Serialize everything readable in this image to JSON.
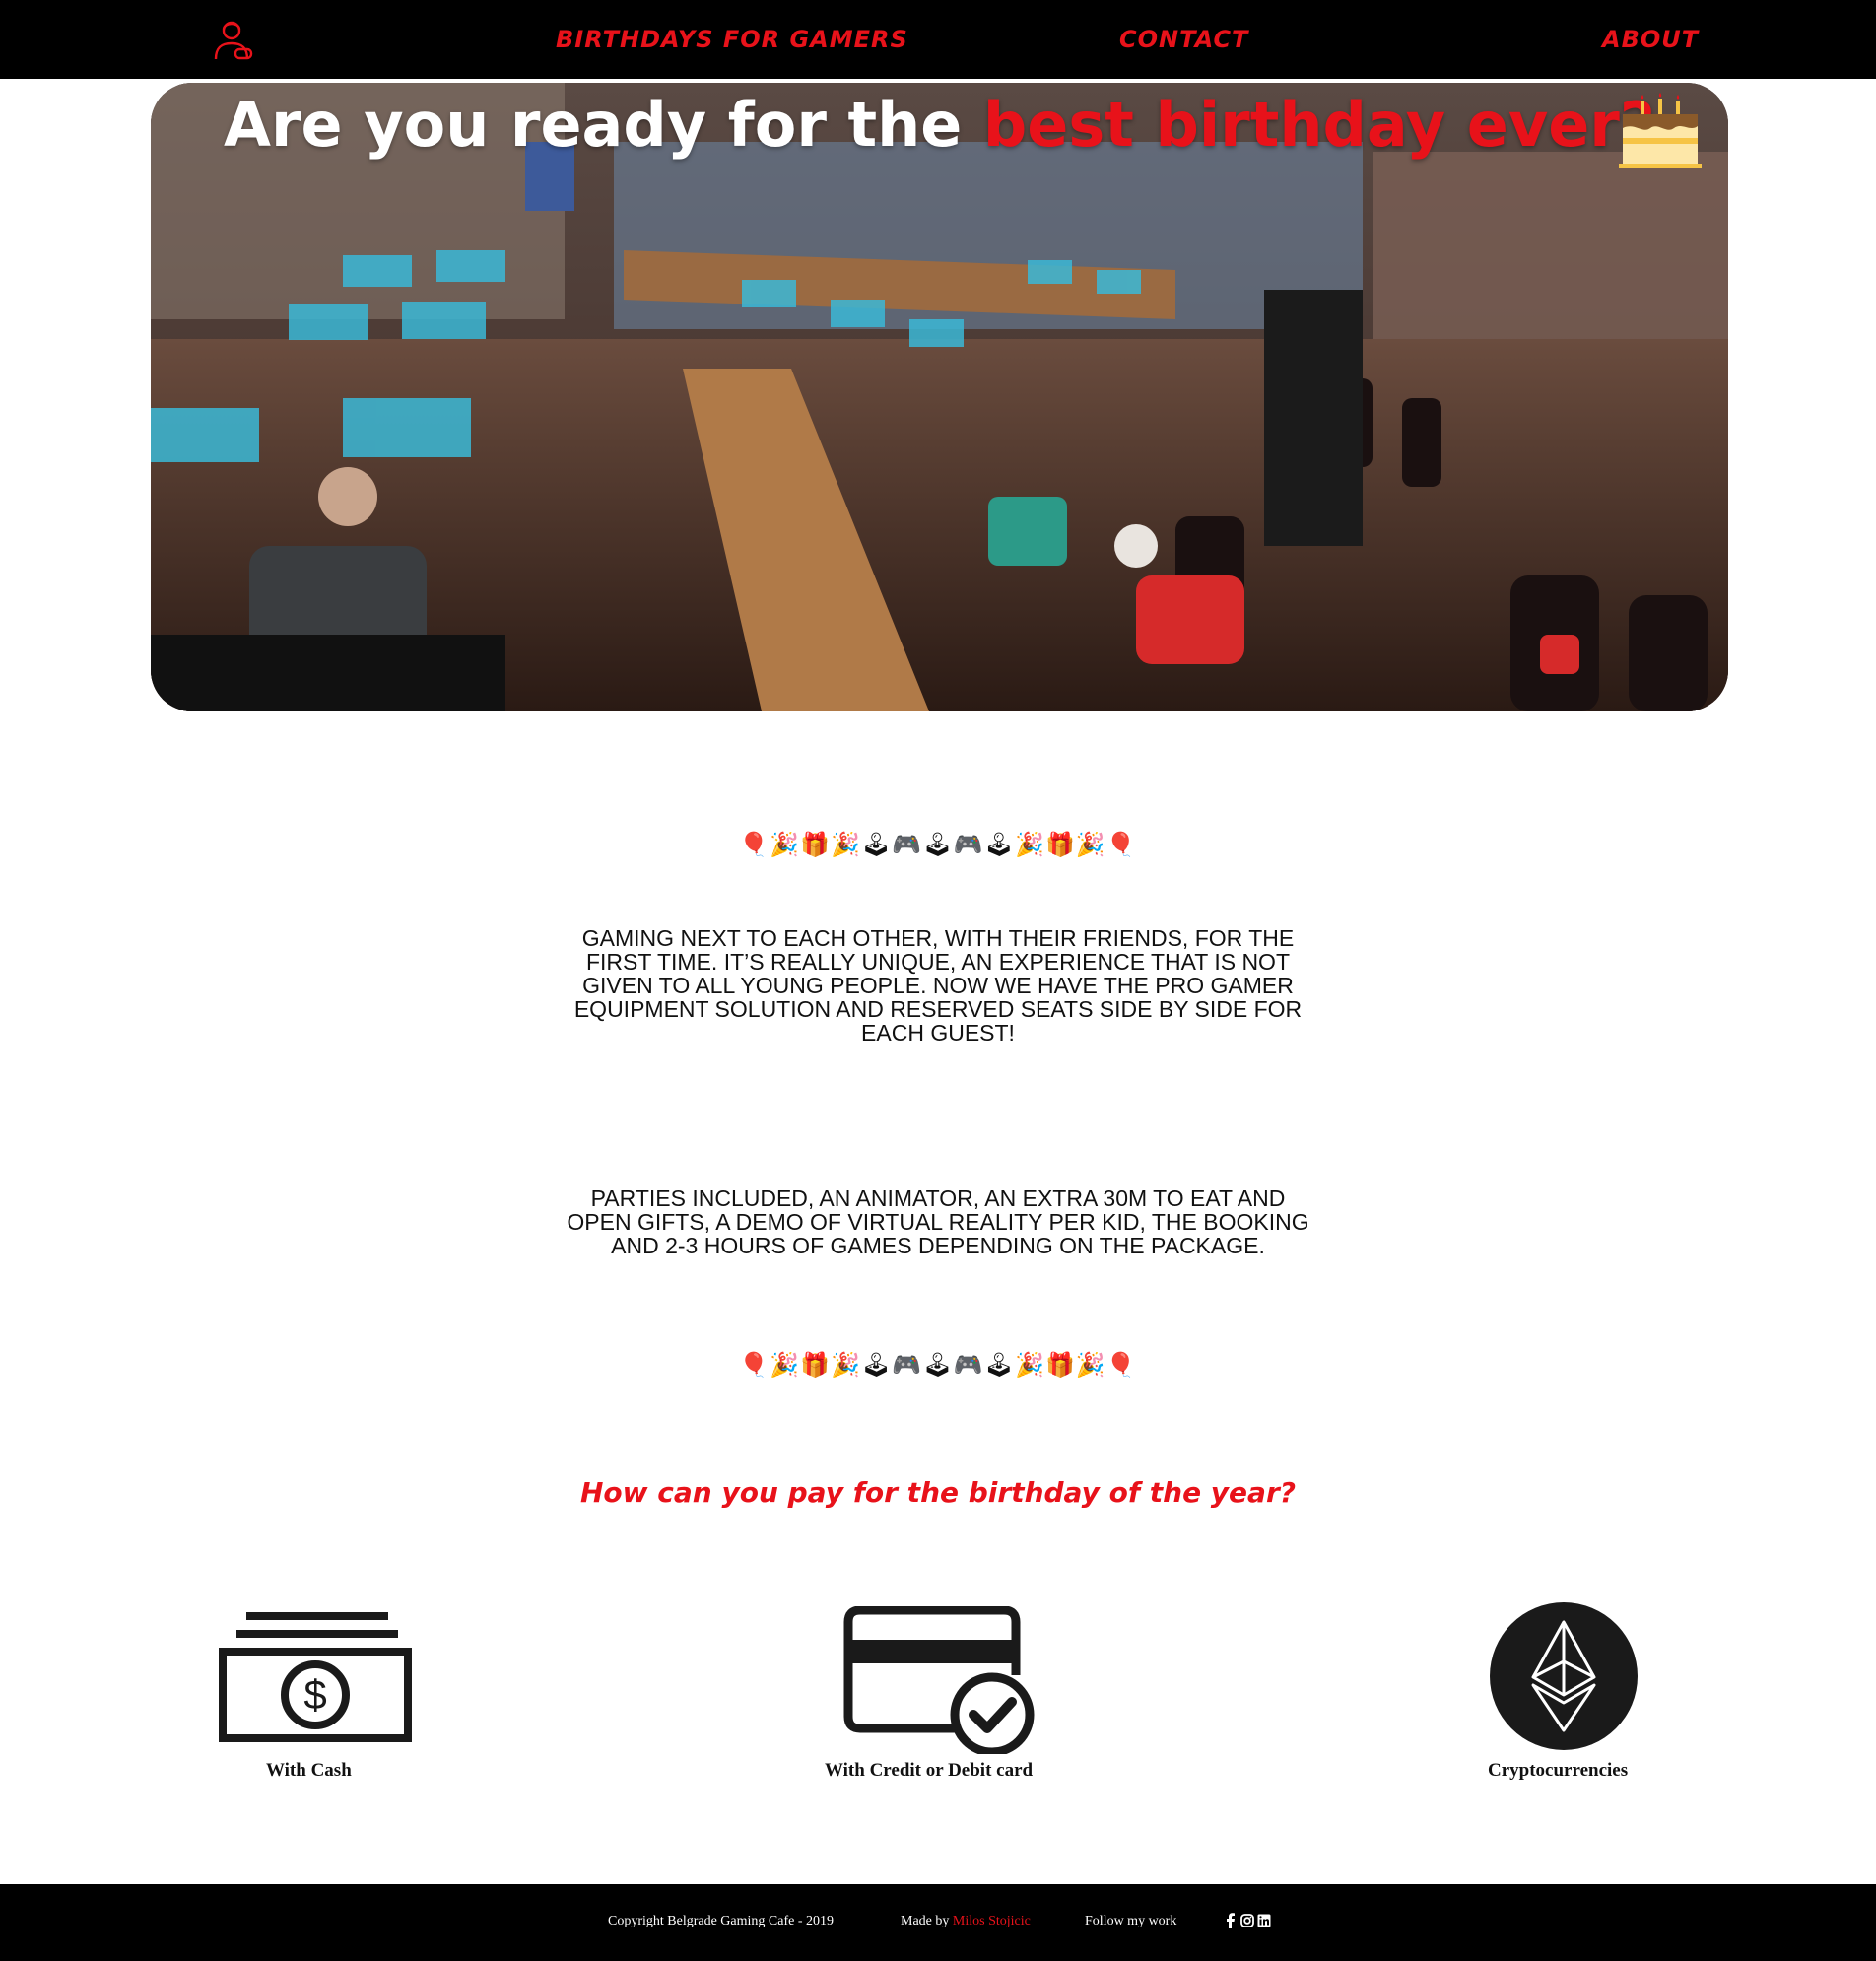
{
  "nav": {
    "logo_icon": "gamer-headset-icon",
    "links": [
      "BIRTHDAYS FOR GAMERS",
      "CONTACT",
      "ABOUT"
    ]
  },
  "hero": {
    "title_part1": "Are you ready for the ",
    "title_highlight": "best birthday ever?",
    "cake_icon": "birthday-cake-icon"
  },
  "emoji_strip": "🎈🎉🎁🎉🕹🎮🕹🎮🕹🎉🎁🎉🎈",
  "paragraphs": [
    "Gaming next to each other, with their friends, for the first time. It’s really unique, an experience that is not given to all young people. Now we have the pro gamer equipment solution and reserved seats side by side for each guest!",
    "Parties included, an animator, an extra 30m to eat and open gifts, a demo of virtual reality per kid, the booking and 2-3 hours of games depending on the package."
  ],
  "payment": {
    "heading": "How can you pay for the birthday of the year?",
    "options": [
      {
        "label": "With Cash",
        "icon": "cash-icon"
      },
      {
        "label": "With Credit or Debit card",
        "icon": "credit-card-check-icon"
      },
      {
        "label": "Cryptocurrencies",
        "icon": "ethereum-icon"
      }
    ]
  },
  "footer": {
    "copyright": "Copyright Belgrade Gaming Cafe - 2019",
    "made_by_prefix": "Made by ",
    "author": "Milos Stojicic",
    "follow": "Follow my work",
    "social_icons": [
      "facebook-icon",
      "instagram-icon",
      "linkedin-icon"
    ]
  },
  "colors": {
    "accent": "#e8121a",
    "nav_bg": "#000000",
    "footer_bg": "#000000"
  }
}
